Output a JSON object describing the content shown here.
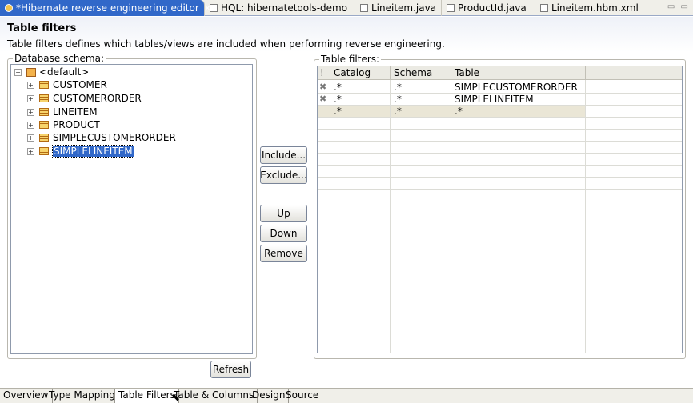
{
  "tabs": [
    {
      "label": "*Hibernate reverse engineering editor",
      "icon": "hibernate-icon",
      "active": true
    },
    {
      "label": "HQL: hibernatetools-demo",
      "icon": "hql-icon",
      "active": false
    },
    {
      "label": "Lineitem.java",
      "icon": "java-file-icon",
      "active": false
    },
    {
      "label": "ProductId.java",
      "icon": "java-file-icon",
      "active": false
    },
    {
      "label": "Lineitem.hbm.xml",
      "icon": "xml-file-icon",
      "active": false
    }
  ],
  "close_glyph": "✕",
  "window_controls": "▭ ▭",
  "header": {
    "title": "Table filters",
    "description": "Table filters defines which tables/views are included when performing reverse engineering."
  },
  "schema": {
    "legend": "Database schema:",
    "root": "<default>",
    "tables": [
      "CUSTOMER",
      "CUSTOMERORDER",
      "LINEITEM",
      "PRODUCT",
      "SIMPLECUSTOMERORDER",
      "SIMPLELINEITEM"
    ],
    "selected": "SIMPLELINEITEM",
    "expand_glyph": "+",
    "collapse_glyph": "−"
  },
  "buttons": {
    "include": "Include...",
    "exclude": "Exclude...",
    "up": "Up",
    "down": "Down",
    "remove": "Remove",
    "refresh": "Refresh"
  },
  "filters": {
    "legend": "Table filters:",
    "columns": [
      "!",
      "Catalog",
      "Schema",
      "Table"
    ],
    "rows": [
      {
        "flag": "✖",
        "catalog": ".*",
        "schema": ".*",
        "table": "SIMPLECUSTOMERORDER"
      },
      {
        "flag": "✖",
        "catalog": ".*",
        "schema": ".*",
        "table": "SIMPLELINEITEM"
      },
      {
        "flag": "",
        "catalog": ".*",
        "schema": ".*",
        "table": ".*"
      }
    ]
  },
  "page_tabs": [
    {
      "label": "Overview",
      "active": false
    },
    {
      "label": "Type Mappings",
      "active": false
    },
    {
      "label": "Table Filters",
      "active": true
    },
    {
      "label": "Table & Columns",
      "active": false
    },
    {
      "label": "Design",
      "active": false
    },
    {
      "label": "Source",
      "active": false
    }
  ],
  "colors": {
    "accent": "#3168c9",
    "highlight_row": "#eae6d6"
  }
}
